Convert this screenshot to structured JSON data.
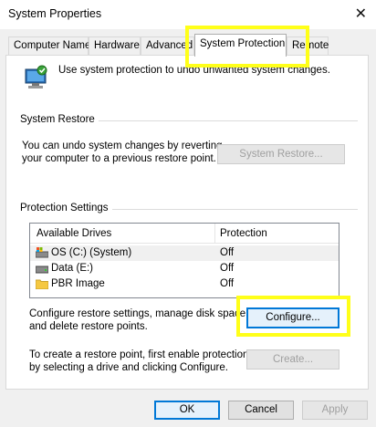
{
  "window": {
    "title": "System Properties",
    "close_glyph": "✕"
  },
  "tabs": [
    {
      "label": "Computer Name",
      "active": false
    },
    {
      "label": "Hardware",
      "active": false
    },
    {
      "label": "Advanced",
      "active": false
    },
    {
      "label": "System Protection",
      "active": true
    },
    {
      "label": "Remote",
      "active": false
    }
  ],
  "intro": {
    "text": "Use system protection to undo unwanted system changes.",
    "icon": "computer-shield-icon"
  },
  "system_restore": {
    "heading": "System Restore",
    "description_line1": "You can undo system changes by reverting",
    "description_line2": "your computer to a previous restore point.",
    "button_label": "System Restore..."
  },
  "protection": {
    "heading": "Protection Settings",
    "columns": [
      "Available Drives",
      "Protection"
    ],
    "drives": [
      {
        "name": "OS (C:) (System)",
        "protection": "Off",
        "icon": "system-drive-icon"
      },
      {
        "name": "Data (E:)",
        "protection": "Off",
        "icon": "drive-icon"
      },
      {
        "name": "PBR Image",
        "protection": "Off",
        "icon": "folder-icon"
      }
    ],
    "configure_line1": "Configure restore settings, manage disk space,",
    "configure_line2": "and delete restore points.",
    "configure_label": "Configure...",
    "create_line1": "To create a restore point, first enable protection",
    "create_line2": "by selecting a drive and clicking Configure.",
    "create_label": "Create..."
  },
  "footer": {
    "ok": "OK",
    "cancel": "Cancel",
    "apply": "Apply"
  },
  "colors": {
    "highlight": "#ffff19",
    "focus": "#0078d7"
  }
}
